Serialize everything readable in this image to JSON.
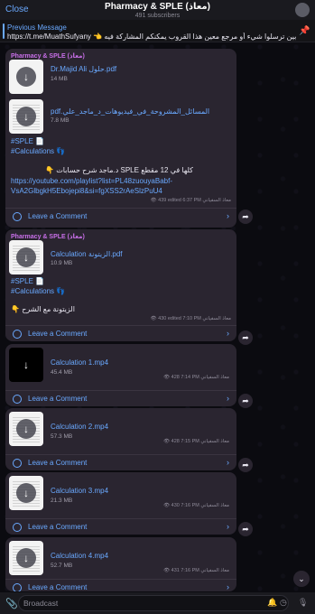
{
  "header": {
    "close_label": "Close",
    "title": "Pharmacy & SPLE (معاذ)",
    "subtitle": "491 subscribers",
    "avatar_icon": "channel-avatar"
  },
  "pinned": {
    "label": "Previous Message",
    "text": "https://t.me/MuathSufyany 👈 ولو حابين ترسلوا شيء أو مرجع معين هذا القروب يمكنكم المشاركة فيه"
  },
  "channel_name": "Pharmacy & SPLE (معاذ)",
  "posts": [
    {
      "files": [
        {
          "name": "Dr.Majid Ali حلول.pdf",
          "size": "14 MB"
        },
        {
          "name": "pdf.المسائل_المشروحة_في_فيديوهات_د_ماجد_علي",
          "size": "7.8 MB"
        }
      ],
      "lines": [
        "#SPLE 📄",
        "#Calculations 👣",
        "👇 د.ماجد شرح حسابات SPLE كلها في 12 مقطع",
        "https://youtube.com/playlist?list=PL48zuouyaBabf-",
        "VsA2GlbgkH5Ebojepi8&si=fgXSS2rAeSlzPuU4"
      ],
      "meta": "👁 439 edited 6:37 PM معاذ السفياني",
      "comment_label": "Leave a Comment"
    },
    {
      "files": [
        {
          "name": "Calculation الزيتونة.pdf",
          "size": "10.9 MB"
        }
      ],
      "lines": [
        "#SPLE 📄",
        "#Calculations 👣",
        "👇 الزيتونة مع الشرح"
      ],
      "meta": "👁 430 edited 7:10 PM معاذ السفياني",
      "comment_label": "Leave a Comment"
    },
    {
      "files": [
        {
          "name": "Calculation 1.mp4",
          "size": "45.4 MB",
          "meta": "👁 428 7:14 PM معاذ السفياني"
        }
      ],
      "comment_label": "Leave a Comment"
    },
    {
      "files": [
        {
          "name": "Calculation 2.mp4",
          "size": "57.3 MB",
          "meta": "👁 428 7:15 PM معاذ السفياني"
        }
      ],
      "comment_label": "Leave a Comment"
    },
    {
      "files": [
        {
          "name": "Calculation 3.mp4",
          "size": "21.3 MB",
          "meta": "👁 430 7:16 PM معاذ السفياني"
        }
      ],
      "comment_label": "Leave a Comment"
    },
    {
      "files": [
        {
          "name": "Calculation 4.mp4",
          "size": "52.7 MB",
          "meta": "👁 431 7:16 PM معاذ السفياني"
        }
      ],
      "comment_label": "Leave a Comment"
    }
  ],
  "bottom": {
    "placeholder": "Broadcast"
  },
  "colors": {
    "accent": "#6aa9ff",
    "channel_name": "#c86fe8",
    "bubble": "#2a2530"
  }
}
